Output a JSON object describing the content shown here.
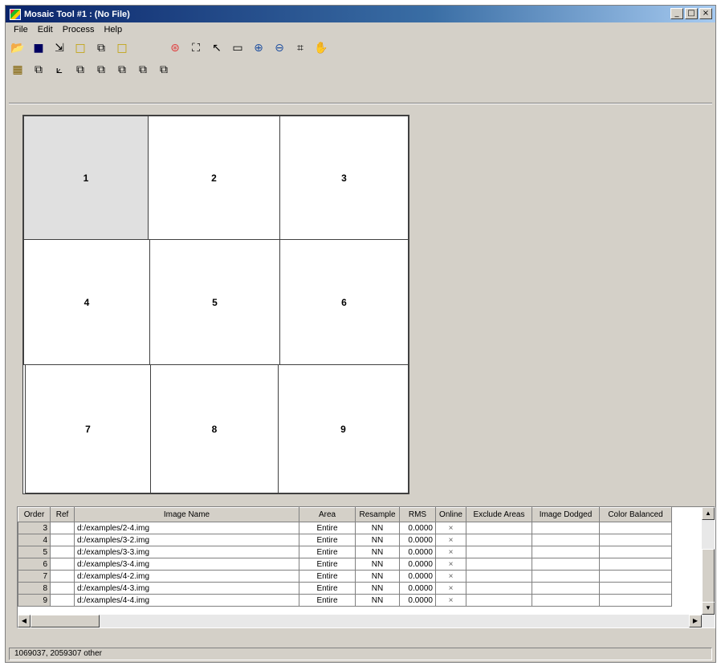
{
  "window": {
    "title": "Mosaic Tool #1 : (No File)",
    "controls": [
      "_",
      "□",
      "×"
    ]
  },
  "menu": [
    "File",
    "Edit",
    "Process",
    "Help"
  ],
  "toolbar1": [
    {
      "icon": "open-folder-icon",
      "glyph": "📂"
    },
    {
      "icon": "save-icon",
      "glyph": "■"
    },
    {
      "icon": "import-icon",
      "glyph": "⇲"
    },
    {
      "icon": "box-outline-icon",
      "glyph": "□"
    },
    {
      "icon": "copy-box-icon",
      "glyph": "⧉"
    },
    {
      "icon": "square-icon",
      "glyph": "□"
    },
    {
      "icon": "target-icon",
      "glyph": "⊛"
    },
    {
      "icon": "fit-extent-icon",
      "glyph": "⛶"
    },
    {
      "icon": "select-arrow-icon",
      "glyph": "↖"
    },
    {
      "icon": "marquee-icon",
      "glyph": "▭"
    },
    {
      "icon": "zoom-in-icon",
      "glyph": "⊕"
    },
    {
      "icon": "zoom-out-icon",
      "glyph": "⊖"
    },
    {
      "icon": "crop-icon",
      "glyph": "⌗"
    },
    {
      "icon": "pan-hand-icon",
      "glyph": "✋"
    }
  ],
  "toolbar2": [
    {
      "icon": "grid-view-icon",
      "glyph": "▦"
    },
    {
      "icon": "overlap-icon",
      "glyph": "⧉"
    },
    {
      "icon": "cutline-icon",
      "glyph": "⟀"
    },
    {
      "icon": "stack-a-icon",
      "glyph": "⧉"
    },
    {
      "icon": "stack-b-icon",
      "glyph": "⧉"
    },
    {
      "icon": "stack-c-icon",
      "glyph": "⧉"
    },
    {
      "icon": "stack-d-icon",
      "glyph": "⧉"
    },
    {
      "icon": "stack-e-icon",
      "glyph": "⧉"
    }
  ],
  "tiles": [
    "1",
    "2",
    "3",
    "4",
    "5",
    "6",
    "7",
    "8",
    "9"
  ],
  "table": {
    "columns": [
      "Order",
      "Ref",
      "Image Name",
      "Area",
      "Resample",
      "RMS",
      "Online",
      "Exclude Areas",
      "Image Dodged",
      "Color Balanced"
    ],
    "rows": [
      {
        "order": "3",
        "name": "d:/examples/2-4.img",
        "area": "Entire",
        "resample": "NN",
        "rms": "0.0000",
        "online": "×"
      },
      {
        "order": "4",
        "name": "d:/examples/3-2.img",
        "area": "Entire",
        "resample": "NN",
        "rms": "0.0000",
        "online": "×"
      },
      {
        "order": "5",
        "name": "d:/examples/3-3.img",
        "area": "Entire",
        "resample": "NN",
        "rms": "0.0000",
        "online": "×"
      },
      {
        "order": "6",
        "name": "d:/examples/3-4.img",
        "area": "Entire",
        "resample": "NN",
        "rms": "0.0000",
        "online": "×"
      },
      {
        "order": "7",
        "name": "d:/examples/4-2.img",
        "area": "Entire",
        "resample": "NN",
        "rms": "0.0000",
        "online": "×"
      },
      {
        "order": "8",
        "name": "d:/examples/4-3.img",
        "area": "Entire",
        "resample": "NN",
        "rms": "0.0000",
        "online": "×"
      },
      {
        "order": "9",
        "name": "d:/examples/4-4.img",
        "area": "Entire",
        "resample": "NN",
        "rms": "0.0000",
        "online": "×"
      }
    ]
  },
  "status": "1069037, 2059307 other"
}
